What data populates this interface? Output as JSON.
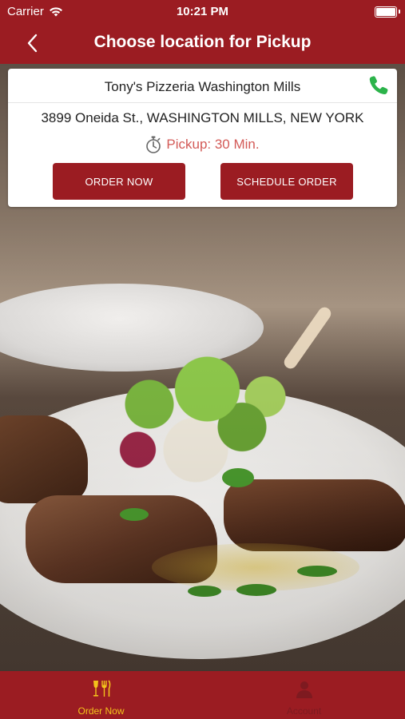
{
  "status_bar": {
    "carrier": "Carrier",
    "time": "10:21 PM",
    "icons": [
      "wifi-icon",
      "battery-icon"
    ]
  },
  "nav": {
    "title": "Choose location for Pickup",
    "back_icon": "chevron-left-icon"
  },
  "location": {
    "name": "Tony's Pizzeria Washington Mills",
    "address": "3899 Oneida St., WASHINGTON MILLS, NEW YORK",
    "pickup_time": "Pickup: 30 Min.",
    "pickup_icon": "stopwatch-icon",
    "phone_icon": "phone-icon",
    "order_now_label": "ORDER NOW",
    "schedule_label": "SCHEDULE ORDER"
  },
  "tabs": [
    {
      "label": "Order Now",
      "icon": "dining-icon",
      "active": true
    },
    {
      "label": "Account",
      "icon": "account-icon",
      "active": false
    }
  ],
  "colors": {
    "brand": "#9b1c22",
    "active_tab": "#f3c21c",
    "pickup_text": "#d35a57",
    "phone_green": "#2bb34a"
  }
}
